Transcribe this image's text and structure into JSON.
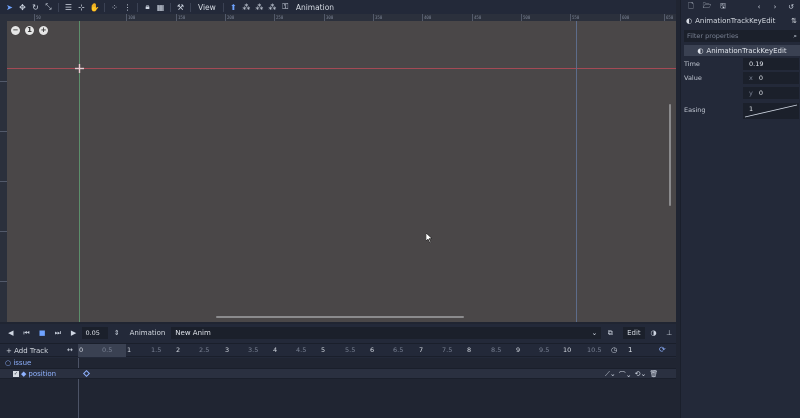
{
  "toolbar": {
    "view_label": "View",
    "animation_label": "Animation",
    "icons": [
      "select-icon",
      "move-icon",
      "rotate-icon",
      "scale-icon",
      "list-select-icon",
      "pivot-icon",
      "pan-icon",
      "snap-icon",
      "grid-icon",
      "ruler-icon",
      "lock-icon",
      "group-icon",
      "bone-icon"
    ]
  },
  "viewport": {
    "zoom_out": "−",
    "zoom_reset": "1",
    "zoom_in": "+",
    "ruler_top": [
      "50",
      "100",
      "150",
      "200",
      "250",
      "300",
      "350",
      "400",
      "450",
      "500",
      "550",
      "600",
      "650"
    ],
    "ruler_left": [
      "50",
      "100",
      "150",
      "200",
      "250",
      "300"
    ]
  },
  "inspector": {
    "title": "AnimationTrackKeyEdit",
    "filter_placeholder": "Filter properties",
    "section": "AnimationTrackKeyEdit",
    "time_label": "Time",
    "time_value": "0.19",
    "value_label": "Value",
    "value_x_axis": "x",
    "value_x": "0",
    "value_y_axis": "y",
    "value_y": "0",
    "easing_label": "Easing",
    "easing_value": "1"
  },
  "animation": {
    "step": "0.05",
    "label": "Animation",
    "anim_name": "New Anim",
    "edit_label": "Edit",
    "add_track": "+ Add Track",
    "ticks": [
      "0",
      "0.5",
      "1",
      "1.5",
      "2",
      "2.5",
      "3",
      "3.5",
      "4",
      "4.5",
      "5",
      "5.5",
      "6",
      "6.5",
      "7",
      "7.5",
      "8",
      "8.5",
      "9",
      "9.5",
      "10",
      "10.5"
    ],
    "length": "1",
    "track_group": "issue",
    "track_property": "position"
  },
  "colors": {
    "accent": "#6fa3ff",
    "viewport_bg": "#4a4748",
    "axis_x": "#a44a55",
    "axis_y": "#5c8e6b"
  }
}
